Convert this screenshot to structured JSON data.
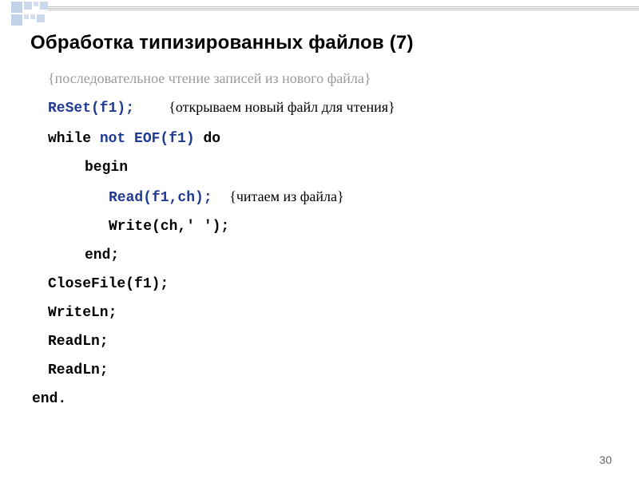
{
  "title": "Обработка типизированных файлов (7)",
  "lines": {
    "comment_header": "{последовательное чтение записей из нового файла}",
    "reset_call": "ReSet(f1);",
    "reset_comment": "{открываем новый файл для чтения}",
    "while_kw": "while ",
    "not_kw": "not",
    "eof_call": " EOF(f1)",
    "do_kw": " do",
    "begin_kw": "begin",
    "read_call": "Read(f1,ch);",
    "read_comment": "{читаем из файла}",
    "write_call": "Write(ch,' ');",
    "end_kw": "end;",
    "closefile": "CloseFile(f1);",
    "writeln": "WriteLn;",
    "readln1": "ReadLn;",
    "readln2": "ReadLn;",
    "enddot": "end."
  },
  "page_number": "30"
}
